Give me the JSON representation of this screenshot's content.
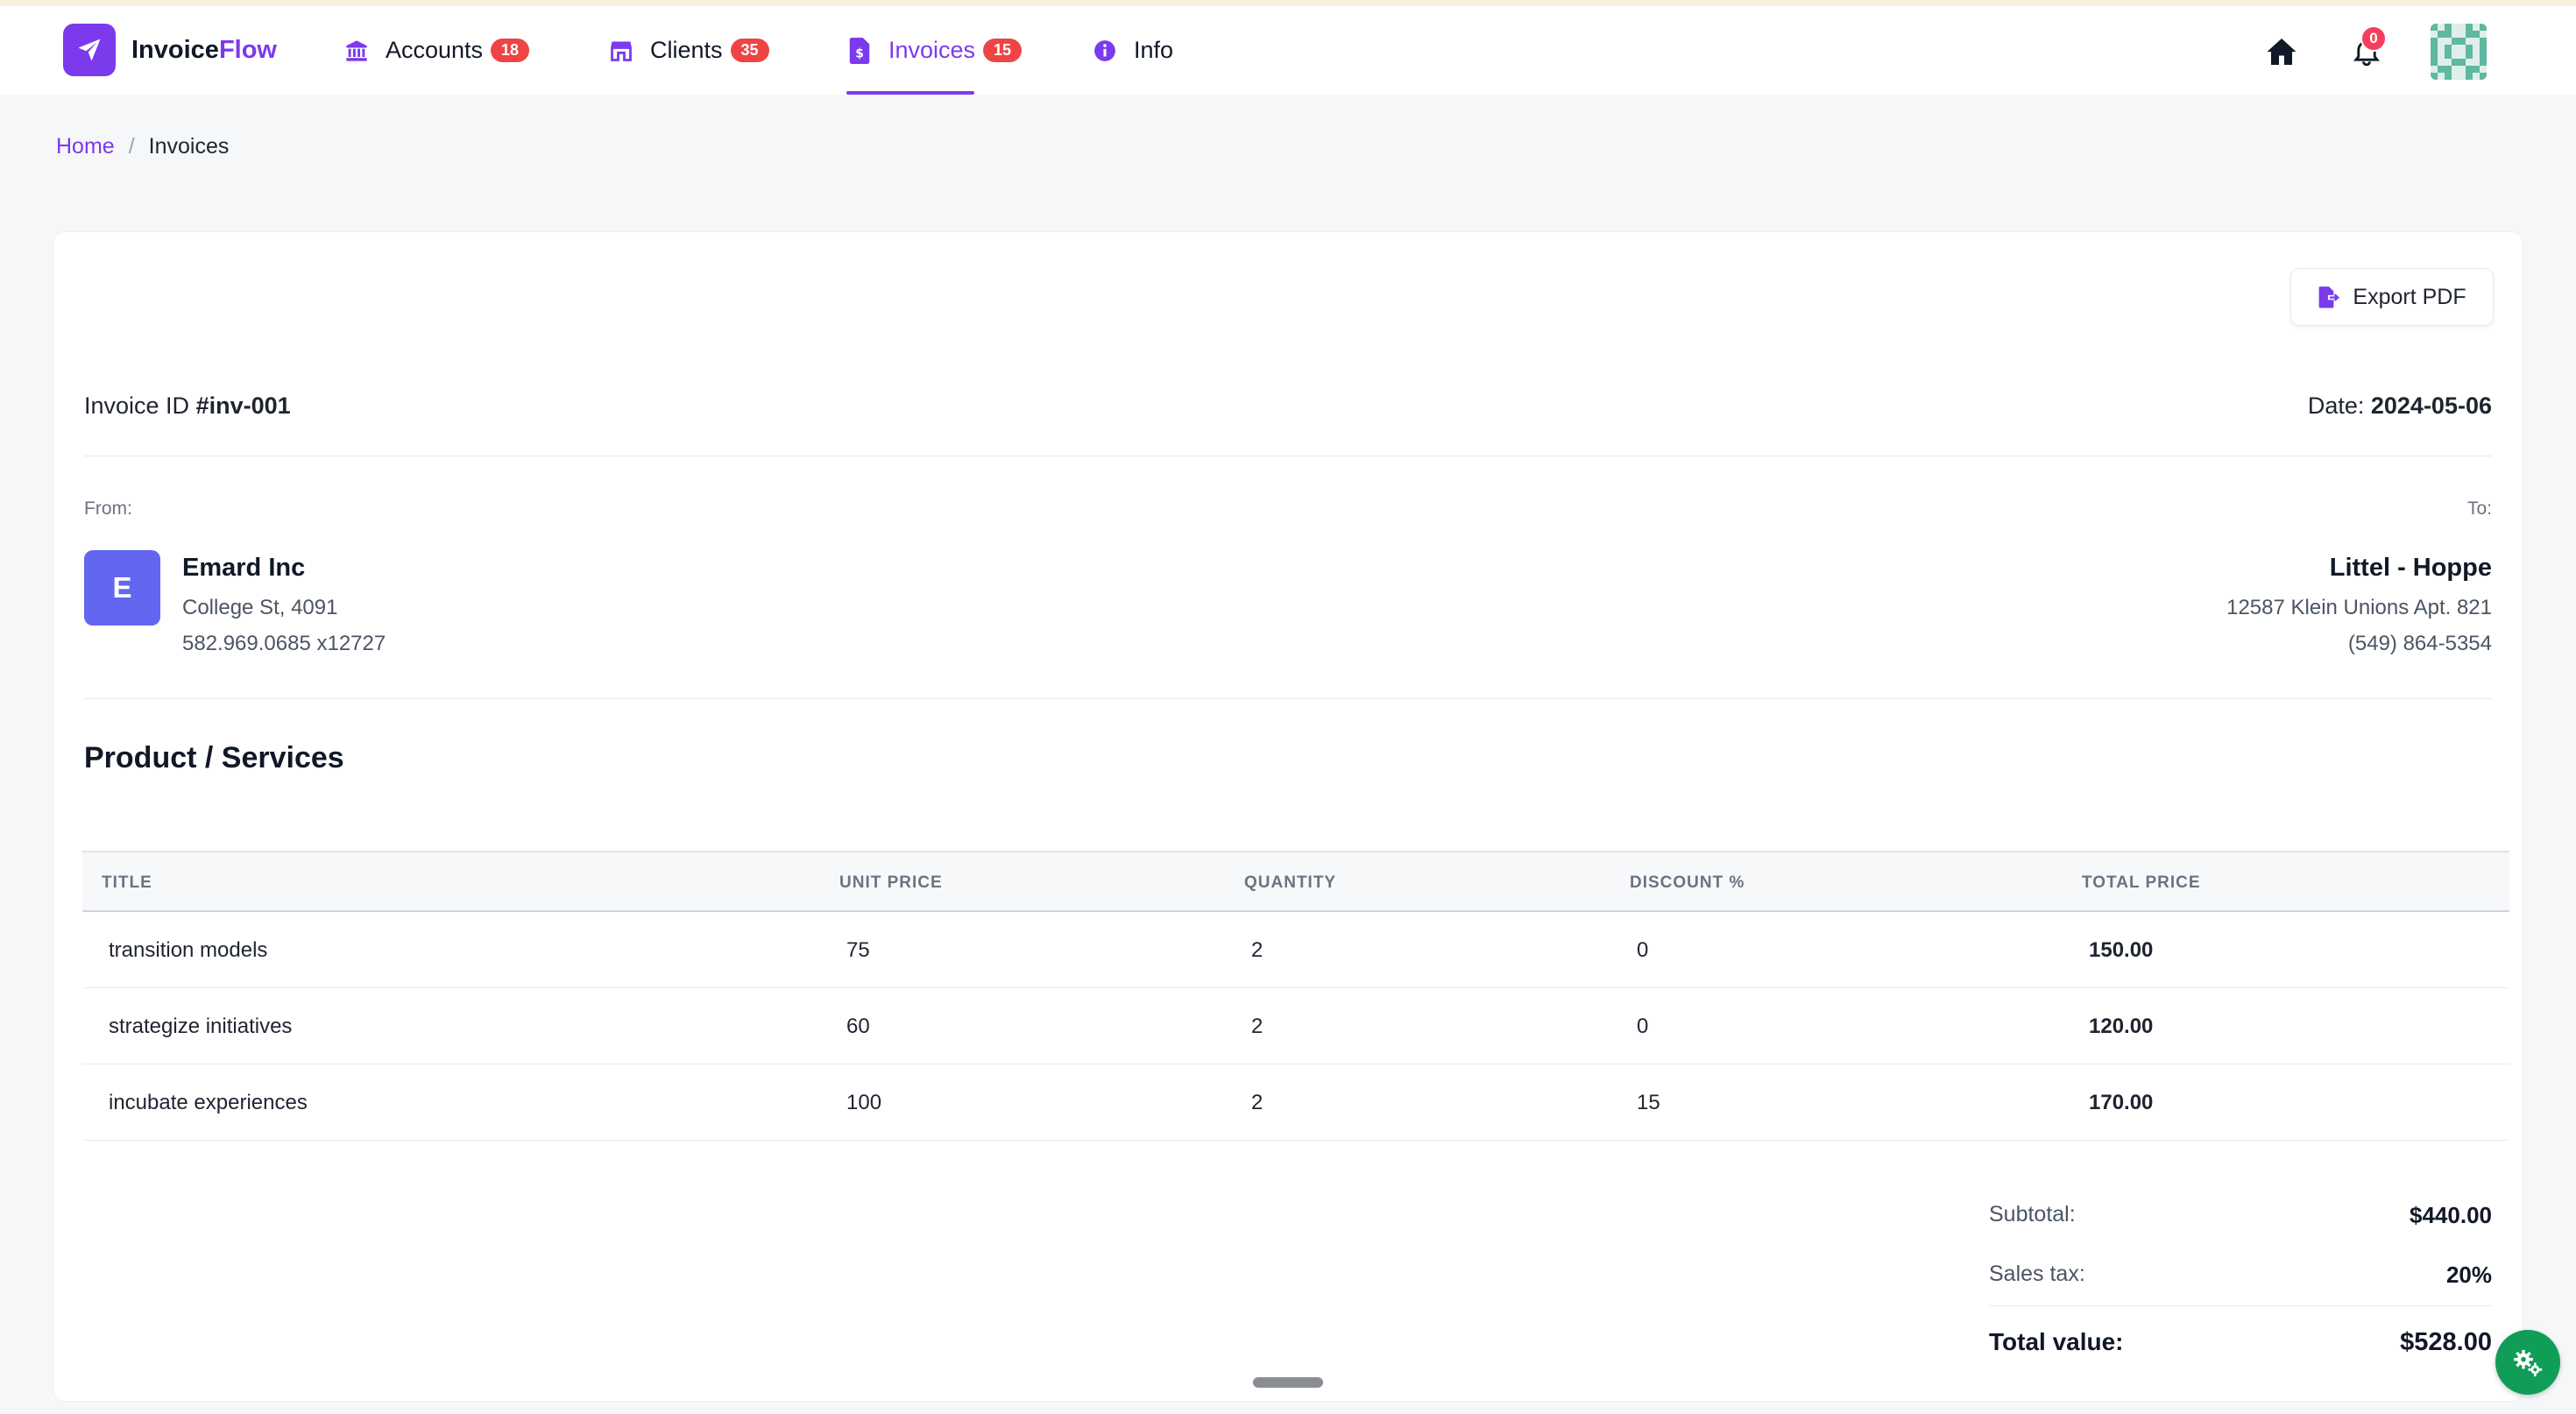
{
  "app": {
    "brand_part1": "Invoice",
    "brand_part2": "Flow",
    "brand_color": "#7c3aed",
    "logo_icon": "paper-plane-icon"
  },
  "nav": {
    "items": [
      {
        "label": "Accounts",
        "badge": "18",
        "icon": "bank-icon",
        "active": false
      },
      {
        "label": "Clients",
        "badge": "35",
        "icon": "store-icon",
        "active": false
      },
      {
        "label": "Invoices",
        "badge": "15",
        "icon": "invoice-file-icon",
        "active": true
      },
      {
        "label": "Info",
        "badge": "",
        "icon": "info-circle-icon",
        "active": false
      }
    ],
    "notifications_count": "0"
  },
  "breadcrumb": {
    "home": "Home",
    "separator": "/",
    "current": "Invoices"
  },
  "invoice": {
    "export_label": "Export PDF",
    "id_prefix": "Invoice ID ",
    "id_value": "#inv-001",
    "date_prefix": "Date: ",
    "date_value": "2024-05-06",
    "from_label": "From:",
    "to_label": "To:",
    "from": {
      "initial": "E",
      "name": "Emard Inc",
      "address": "College St, 4091",
      "phone": "582.969.0685 x12727"
    },
    "to": {
      "name": "Littel - Hoppe",
      "address": "12587 Klein Unions Apt. 821",
      "phone": "(549) 864-5354"
    },
    "section_title": "Product / Services",
    "columns": [
      "TITLE",
      "UNIT PRICE",
      "QUANTITY",
      "DISCOUNT %",
      "TOTAL PRICE"
    ],
    "rows": [
      {
        "title": "transition models",
        "unit_price": "75",
        "quantity": "2",
        "discount": "0",
        "total": "150.00"
      },
      {
        "title": "strategize initiatives",
        "unit_price": "60",
        "quantity": "2",
        "discount": "0",
        "total": "120.00"
      },
      {
        "title": "incubate experiences",
        "unit_price": "100",
        "quantity": "2",
        "discount": "15",
        "total": "170.00"
      }
    ],
    "summary": {
      "subtotal_label": "Subtotal:",
      "subtotal_value": "$440.00",
      "tax_label": "Sales tax:",
      "tax_value": "20%",
      "total_label": "Total value:",
      "total_value": "$528.00"
    }
  },
  "colors": {
    "accent": "#7c3aed",
    "badge": "#ef4444",
    "from_avatar": "#6366f1",
    "fab": "#0f9d58"
  }
}
